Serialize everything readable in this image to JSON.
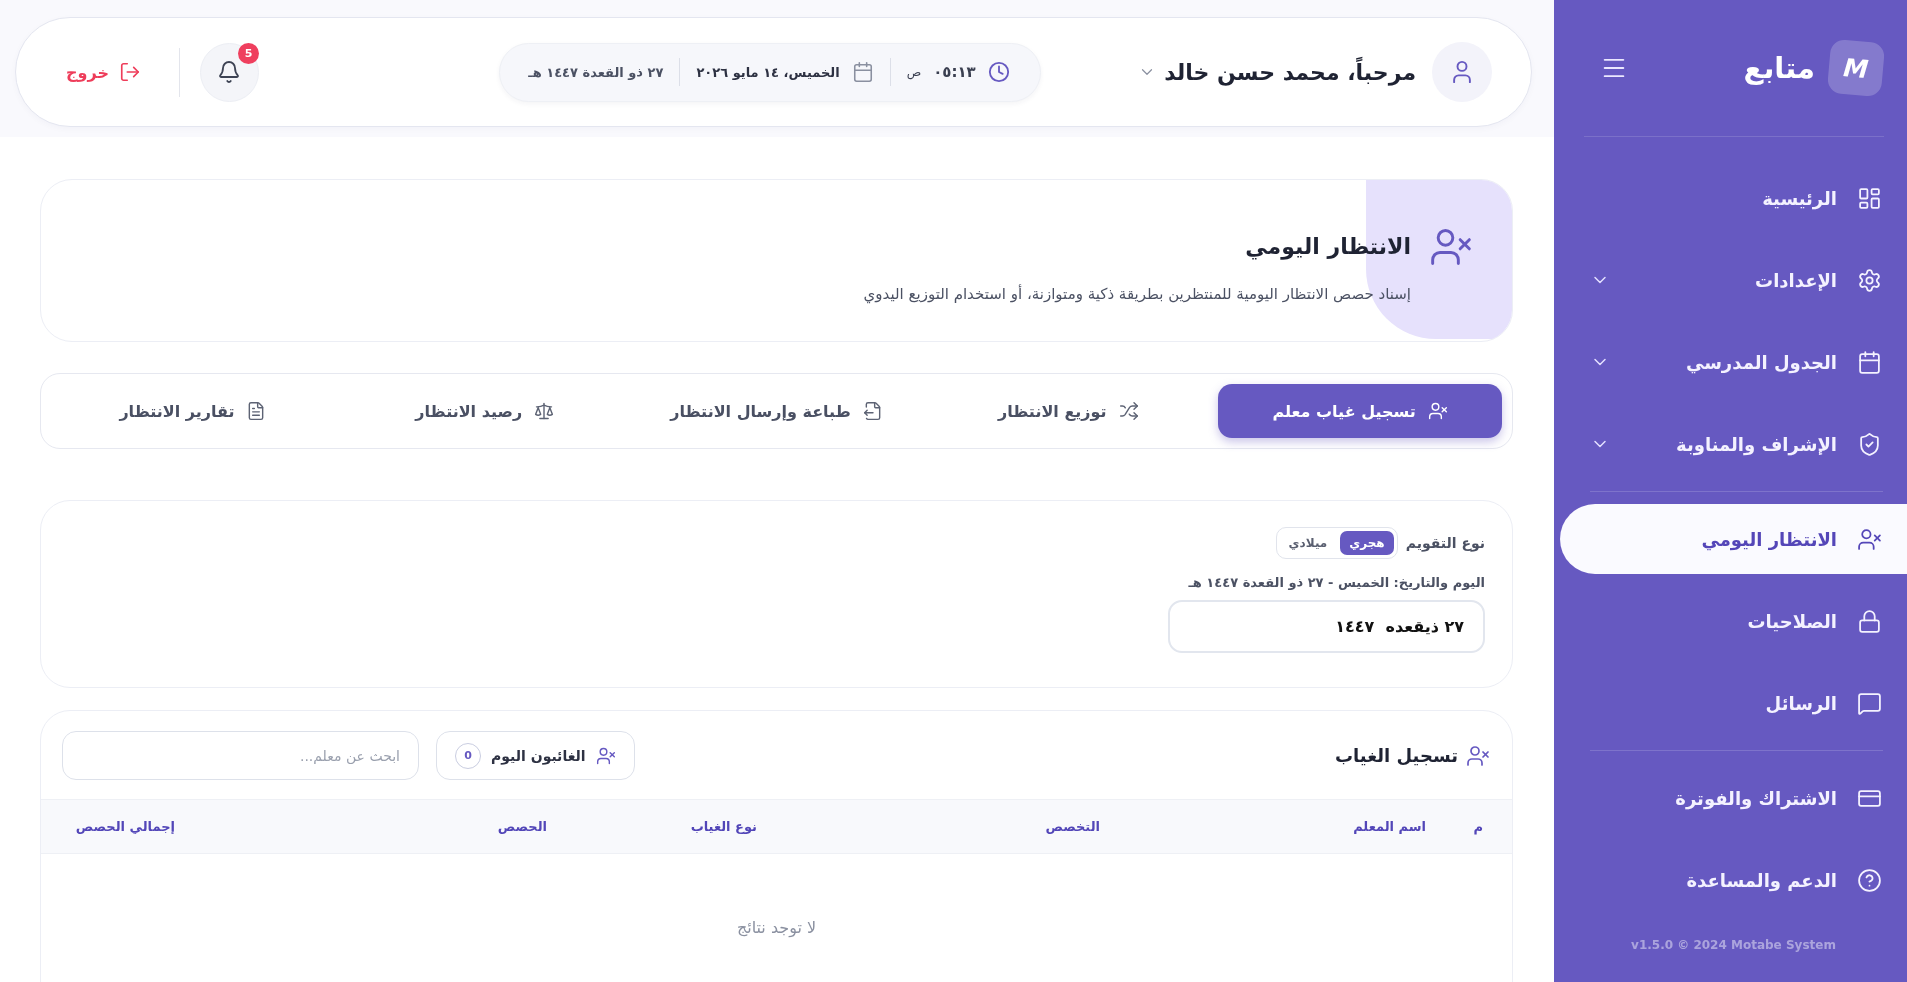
{
  "sidebar": {
    "logo": {
      "letter": "M",
      "name": "متابع"
    },
    "groups": [
      [
        {
          "label": "الرئيسية",
          "has_submenu": false,
          "selected": false
        },
        {
          "label": "الإعدادات",
          "has_submenu": true,
          "selected": false
        },
        {
          "label": "الجدول المدرسي",
          "has_submenu": true,
          "selected": false
        },
        {
          "label": "الإشراف والمناوبة",
          "has_submenu": true,
          "selected": false
        }
      ],
      [
        {
          "label": "الانتظار اليومي",
          "has_submenu": false,
          "selected": true
        },
        {
          "label": "الصلاحيات",
          "has_submenu": false,
          "selected": false
        },
        {
          "label": "الرسائل",
          "has_submenu": false,
          "selected": false
        }
      ],
      [
        {
          "label": "الاشتراك والفوترة",
          "has_submenu": false,
          "selected": false
        },
        {
          "label": "الدعم والمساعدة",
          "has_submenu": false,
          "selected": false
        }
      ]
    ],
    "footer": "v1.5.0 © 2024 Motabe System"
  },
  "top_bar": {
    "greeting": "مرحباً، محمد حسن خالد",
    "clock": {
      "time": "٠٥:١٣",
      "period": "ص"
    },
    "date": "الخميس، ١٤ مايو ٢٠٢٦",
    "hijri_date": "٢٧ ذو القعدة ١٤٤٧ هـ",
    "notifications": {
      "count": "5"
    },
    "logout": "خروج"
  },
  "page_header": {
    "title": "الانتظار اليومي",
    "subtitle": "إسناد حصص الانتظار اليومية للمنتظرين بطريقة ذكية ومتوازنة، أو استخدام التوزيع اليدوي"
  },
  "tabs": [
    {
      "label": "تسجيل غياب معلم",
      "selected": true
    },
    {
      "label": "توزيع الانتظار",
      "selected": false
    },
    {
      "label": "طباعة وإرسال الانتظار",
      "selected": false
    },
    {
      "label": "رصيد الانتظار",
      "selected": false
    },
    {
      "label": "تقارير الانتظار",
      "selected": false
    }
  ],
  "calendar": {
    "label": "نوع التقويم",
    "options": [
      {
        "label": "هجري",
        "selected": true
      },
      {
        "label": "ميلادي",
        "selected": false
      }
    ],
    "date_label": "اليوم والتاريخ: الخميس - ٢٧ ذو القعدة ١٤٤٧ هـ",
    "date_value": "٢٧ ذيقعده  ١٤٤٧"
  },
  "absence": {
    "title": "تسجيل الغياب",
    "absent_today": {
      "label": "الغائبون اليوم",
      "count": "0"
    },
    "search": {
      "placeholder": "ابحث عن معلم..."
    },
    "table": {
      "columns": [
        "م",
        "اسم المعلم",
        "التخصص",
        "نوع الغياب",
        "الحصص",
        "إجمالي الحصص"
      ],
      "empty_message": "لا توجد نتائج"
    }
  }
}
